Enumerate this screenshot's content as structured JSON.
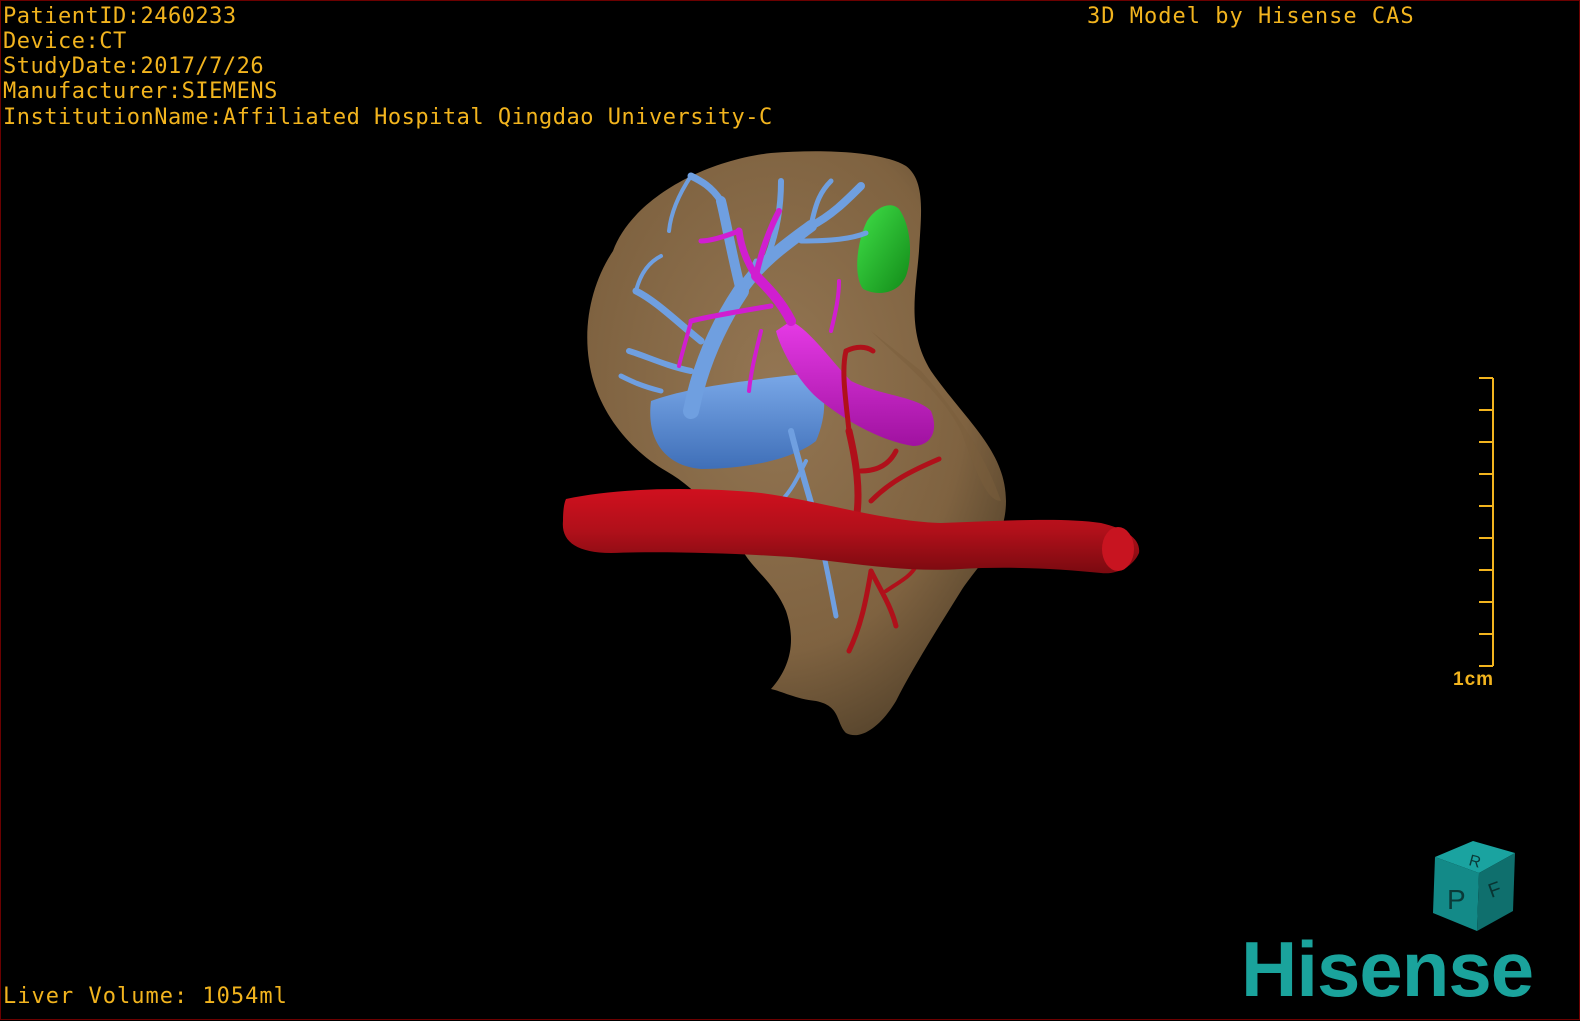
{
  "overlay": {
    "patient_id": "PatientID:2460233",
    "device": "Device:CT",
    "study_date": "StudyDate:2017/7/26",
    "manufacturer": "Manufacturer:SIEMENS",
    "institution": "InstitutionName:Affiliated Hospital Qingdao University-C",
    "credit": "3D Model by Hisense CAS",
    "liver_volume": "Liver Volume: 1054ml"
  },
  "scale": {
    "label": "1cm"
  },
  "orientation_cube": {
    "face_top": "R",
    "face_front": "P",
    "face_side": "F"
  },
  "brand": {
    "logo": "Hisense"
  },
  "colors": {
    "overlay_text": "#f2b41e",
    "liver": "#8a6b46",
    "portal_vein": "#d01ed0",
    "hepatic_vein": "#5a8ed6",
    "artery": "#b0101a",
    "lesion": "#1fbf28",
    "brand": "#1aa39c",
    "cube": "#138a88"
  }
}
